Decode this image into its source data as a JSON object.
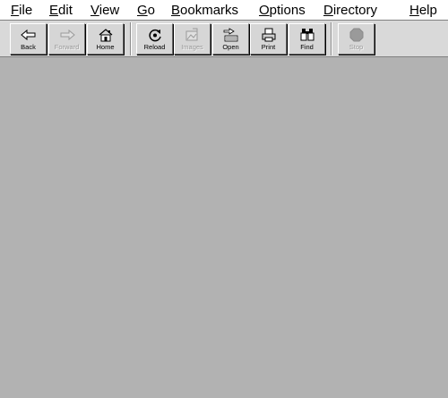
{
  "menubar": {
    "items": [
      {
        "mnemonic": "F",
        "rest": "ile"
      },
      {
        "mnemonic": "E",
        "rest": "dit"
      },
      {
        "mnemonic": "V",
        "rest": "iew"
      },
      {
        "mnemonic": "G",
        "rest": "o"
      },
      {
        "mnemonic": "B",
        "rest": "ookmarks"
      },
      {
        "mnemonic": "O",
        "rest": "ptions"
      },
      {
        "mnemonic": "D",
        "rest": "irectory"
      },
      {
        "mnemonic": "H",
        "rest": "elp"
      }
    ]
  },
  "toolbar": {
    "back": {
      "label": "Back",
      "icon": "back-arrow-icon",
      "enabled": true
    },
    "forward": {
      "label": "Forward",
      "icon": "forward-arrow-icon",
      "enabled": false
    },
    "home": {
      "label": "Home",
      "icon": "home-icon",
      "enabled": true
    },
    "reload": {
      "label": "Reload",
      "icon": "reload-icon",
      "enabled": true
    },
    "images": {
      "label": "Images",
      "icon": "images-icon",
      "enabled": false
    },
    "open": {
      "label": "Open",
      "icon": "open-icon",
      "enabled": true
    },
    "print": {
      "label": "Print",
      "icon": "print-icon",
      "enabled": true
    },
    "find": {
      "label": "Find",
      "icon": "find-binoculars-icon",
      "enabled": true
    },
    "stop": {
      "label": "Stop",
      "icon": "stop-icon",
      "enabled": false
    }
  },
  "colors": {
    "content_background": "#b2b2b2",
    "toolbar_background": "#d9d9d9",
    "menubar_background": "#ffffff",
    "disabled_text": "#9a9a9a"
  }
}
